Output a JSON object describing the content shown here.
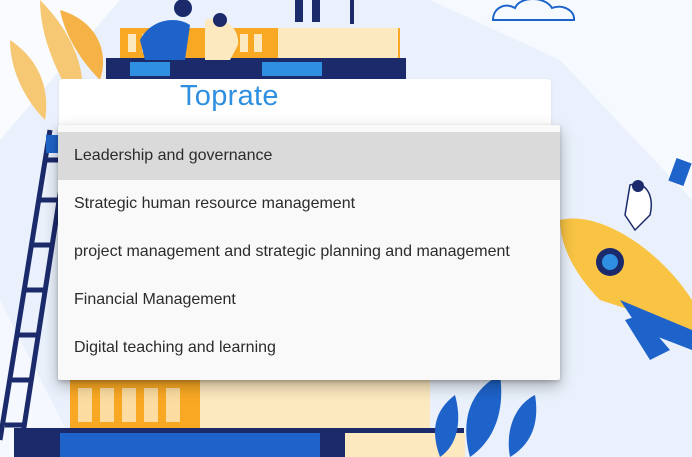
{
  "app": {
    "title": "Toprate"
  },
  "menu": {
    "items": [
      {
        "label": "Leadership and governance",
        "highlighted": true
      },
      {
        "label": "Strategic human resource management",
        "highlighted": false
      },
      {
        "label": "project management and strategic planning and management",
        "highlighted": false
      },
      {
        "label": "Financial Management",
        "highlighted": false
      },
      {
        "label": "Digital teaching and learning",
        "highlighted": false
      }
    ]
  },
  "colors": {
    "title": "#2f8fe0",
    "highlight": "#dadada",
    "menu_bg": "#f9f9f9",
    "illustration_blue": "#1e63c9",
    "illustration_navy": "#1b2a6b",
    "illustration_orange": "#f9a823",
    "illustration_cream": "#fde9c0"
  }
}
